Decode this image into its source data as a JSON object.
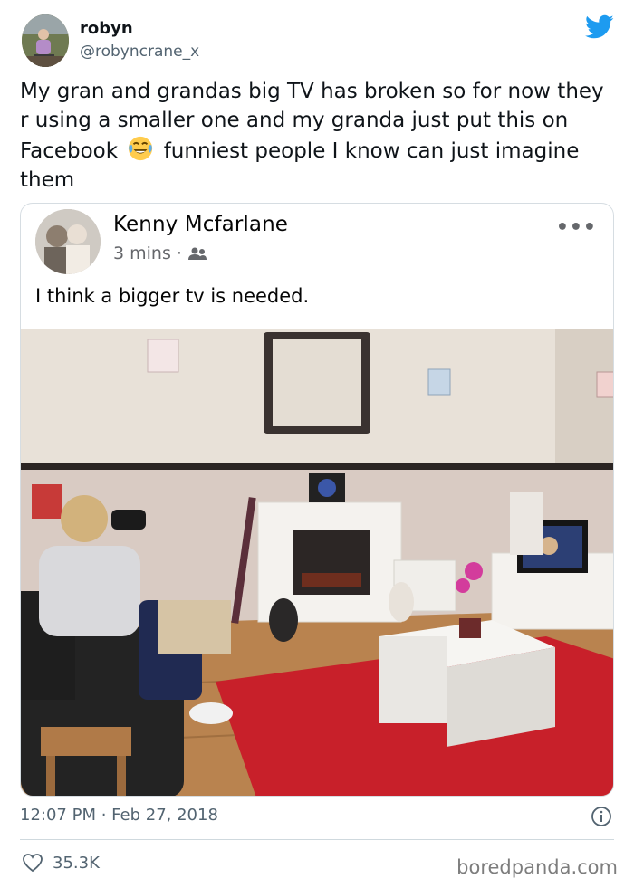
{
  "tweet": {
    "author": {
      "display_name": "robyn",
      "handle": "@robyncrane_x"
    },
    "text_before_emoji": "My gran and grandas big TV has broken so for now they r using a smaller one and my granda just put this on Facebook",
    "emoji": "tears-of-joy-emoji",
    "text_after_emoji": "funniest people I know can just imagine them",
    "timestamp": "12:07 PM · Feb 27, 2018",
    "likes": "35.3K"
  },
  "facebook_post": {
    "author": "Kenny Mcfarlane",
    "time": "3 mins ·",
    "audience_icon": "friends-icon",
    "more_icon": "more-dots-icon",
    "more_label": "•••",
    "text": "I think a bigger tv is needed."
  },
  "watermark": "boredpanda.com",
  "colors": {
    "twitter_blue": "#1d9bf0",
    "secondary_text": "#536471",
    "carpet_red": "#c8202a",
    "wall": "#e6ddd2"
  }
}
